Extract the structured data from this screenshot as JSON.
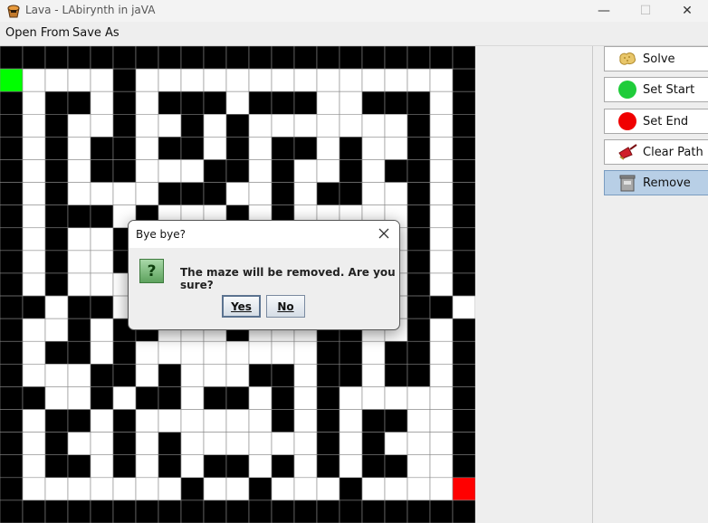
{
  "window": {
    "title": "Lava - LAbirynth in jaVA",
    "minimize_glyph": "—",
    "maximize_glyph": "☐",
    "close_glyph": "✕"
  },
  "menu": [
    "Open From",
    "Save As"
  ],
  "sidebar": [
    {
      "label": "Solve",
      "icon": "sponge-icon"
    },
    {
      "label": "Set Start",
      "icon": "green-dot-icon"
    },
    {
      "label": "Set End",
      "icon": "red-dot-icon"
    },
    {
      "label": "Clear Path",
      "icon": "dustpan-icon"
    },
    {
      "label": "Remove",
      "icon": "trash-bin-icon"
    }
  ],
  "maze": {
    "rows": 21,
    "cols": 21,
    "start": [
      1,
      0
    ],
    "end": [
      19,
      20
    ],
    "grid": [
      "#####################",
      "S    #              #",
      "# ## # ### ###  ### #",
      "# #  #  # #       # #",
      "# # ## ## # ## #  # #",
      "# # ##   ## #  # ## #",
      "# #    ###  # ##  # #",
      "# ### #   # #     # #",
      "# #  ## #   # # # # #",
      "# #  #  # ### # # # #",
      "# #     #   # #   # #",
      "## ## ### #       ## ",
      "#  # ##   #   ##  # #",
      "# ## #        ## ## #",
      "#   ## #   ## ## ## #",
      "##  # ## ## # #     #",
      "# ## #      # # ##  #",
      "# #  # #      # #   #",
      "# ## # # ## # # ##  #",
      "#       #  #   #    E",
      "#####################"
    ],
    "colors": {
      "wall": "#000000",
      "path": "#ffffff",
      "grid": "#888888",
      "start": "#00ff00",
      "end": "#ff0000"
    }
  },
  "dialog": {
    "title": "Bye bye?",
    "message": "The maze will be removed. Are you sure?",
    "yes_label": "Yes",
    "no_label": "No"
  }
}
